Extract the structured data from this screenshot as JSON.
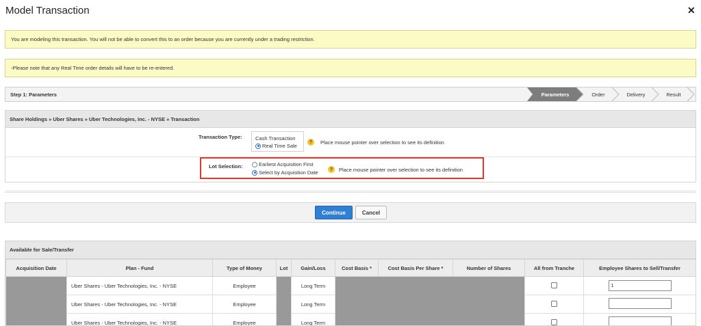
{
  "dialog": {
    "title": "Model Transaction",
    "close_icon": "close-icon"
  },
  "notices": [
    "You are modeling this transaction. You will not be able to convert this to an order because you are currently under a trading restriction.",
    "-Please note that any Real Time order details will have to be re-entered."
  ],
  "steps": {
    "current_label": "Step 1: Parameters",
    "items": [
      "Parameters",
      "Order",
      "Delivery",
      "Result"
    ],
    "active_index": 0
  },
  "breadcrumb": "Share Holdings » Uber Shares » Uber Technologies, Inc. - NYSE » Transaction",
  "transaction_type": {
    "label": "Transaction Type:",
    "options": [
      "Cash Transaction",
      "Real Time Sale"
    ],
    "selected": "Real Time Sale",
    "hint": "Place mouse pointer over selection to see its definition",
    "help_icon": "help-icon"
  },
  "lot_selection": {
    "label": "Lot Selection:",
    "options": [
      "Earliest Acquisition First",
      "Select by Acquisition Date"
    ],
    "selected": "Select by Acquisition Date",
    "hint": "Place mouse pointer over selection to see its definition",
    "help_icon": "help-icon",
    "highlight_color": "#e0372b"
  },
  "actions": {
    "continue_label": "Continue",
    "cancel_label": "Cancel",
    "continue_color": "#2f7fd4"
  },
  "table": {
    "title": "Available for Sale/Transfer",
    "columns": [
      "Acquisition Date",
      "Plan - Fund",
      "Type of Money",
      "Lot",
      "Gain/Loss",
      "Cost Basis *",
      "Cost Basis Per Share *",
      "Number of Shares",
      "All from Tranche",
      "Employee Shares to Sell/Transfer"
    ],
    "rows": [
      {
        "plan_fund": "Uber Shares - Uber Technologies, Inc. - NYSE",
        "type_of_money": "Employee",
        "gain_loss": "Long Term",
        "all_from_tranche": false,
        "shares_to_sell": "1"
      },
      {
        "plan_fund": "Uber Shares - Uber Technologies, Inc. - NYSE",
        "type_of_money": "Employee",
        "gain_loss": "Long Term",
        "all_from_tranche": false,
        "shares_to_sell": ""
      },
      {
        "plan_fund": "Uber Shares - Uber Technologies, Inc. - NYSE",
        "type_of_money": "Employee",
        "gain_loss": "Long Term",
        "all_from_tranche": false,
        "shares_to_sell": ""
      }
    ]
  }
}
